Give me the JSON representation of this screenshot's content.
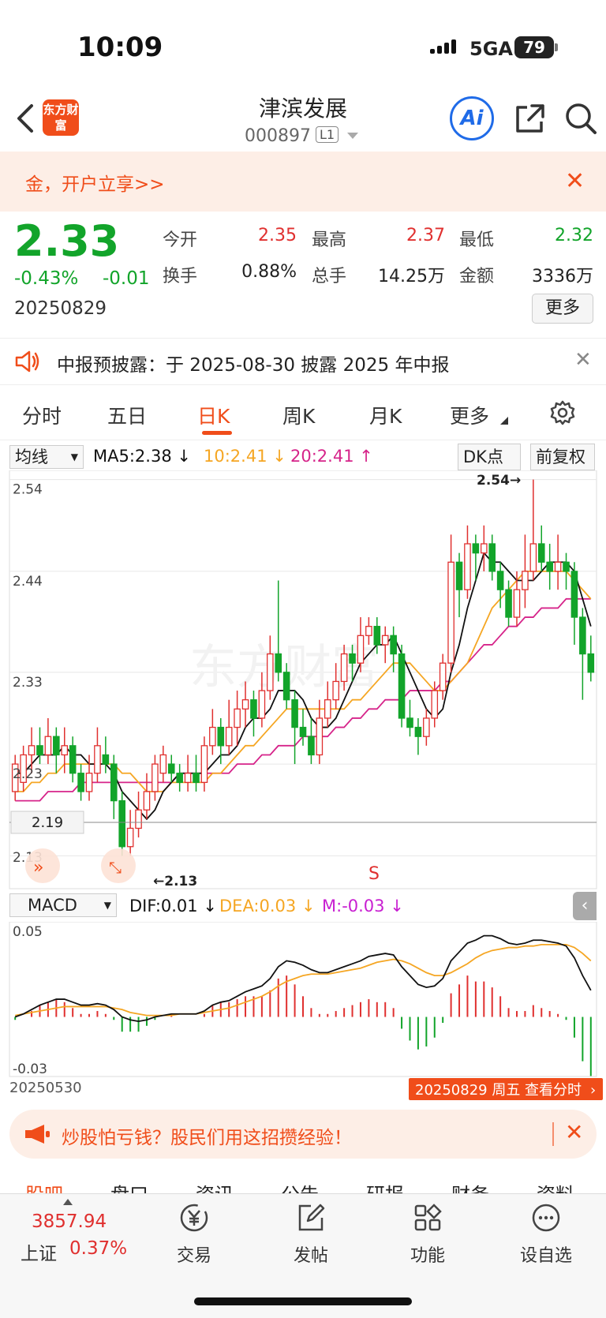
{
  "status_bar": {
    "time": "10:09",
    "network": "5GA",
    "battery": "79"
  },
  "header": {
    "logo_text": "东方财富",
    "stock_name": "津滨发展",
    "stock_code": "000897",
    "level_badge": "L1",
    "ai_label": "Ai"
  },
  "promo": {
    "text": "金，开户立享>>",
    "close": "✕"
  },
  "quote": {
    "price": "2.33",
    "change_pct": "-0.43%",
    "change_amt": "-0.01",
    "date": "20250829",
    "fields": [
      {
        "label": "今开",
        "value": "2.35",
        "color": "#e0302f"
      },
      {
        "label": "最高",
        "value": "2.37",
        "color": "#e0302f"
      },
      {
        "label": "最低",
        "value": "2.32",
        "color": "#12a42a"
      },
      {
        "label": "换手",
        "value": "0.88%",
        "color": "#222222"
      },
      {
        "label": "总手",
        "value": "14.25万",
        "color": "#222222"
      },
      {
        "label": "金额",
        "value": "3336万",
        "color": "#222222"
      }
    ],
    "more_label": "更多"
  },
  "notice": {
    "text": "中报预披露：于 2025-08-30 披露 2025 年中报",
    "close": "✕"
  },
  "tabs": {
    "items": [
      "分时",
      "五日",
      "日K",
      "周K",
      "月K",
      "更多"
    ],
    "active": "日K"
  },
  "ma_bar": {
    "selector": "均线",
    "ma5": "MA5:2.38",
    "ma10": "10:2.41",
    "ma20": "20:2.41",
    "dk_label": "DK点",
    "adjust_label": "前复权"
  },
  "macd_bar": {
    "selector": "MACD",
    "dif": "DIF:0.01",
    "dea": "DEA:0.03",
    "m": "M:-0.03"
  },
  "colors": {
    "up": "#e0302f",
    "down": "#12a42a",
    "ma5": "#111111",
    "ma10": "#f5a623",
    "ma20": "#d6248a",
    "accent": "#f04d1a"
  },
  "chart_data": {
    "type": "candlestick",
    "y_ticks": [
      "2.54",
      "2.44",
      "2.33",
      "2.23",
      "2.13"
    ],
    "ylim": [
      2.12,
      2.55
    ],
    "high_marker": "2.54",
    "low_marker": "2.13",
    "crosshair_value": "2.19",
    "signal_marker": "S",
    "start_date": "20250530",
    "end_label": "20250829 周五 查看分时",
    "macd_ticks": [
      "0.05",
      "-0.03"
    ],
    "macd_ylim": [
      -0.035,
      0.058
    ],
    "candles": [
      [
        2.2,
        2.23,
        2.24,
        2.19
      ],
      [
        2.21,
        2.24,
        2.25,
        2.2
      ],
      [
        2.24,
        2.25,
        2.27,
        2.22
      ],
      [
        2.25,
        2.24,
        2.27,
        2.23
      ],
      [
        2.24,
        2.26,
        2.28,
        2.23
      ],
      [
        2.26,
        2.24,
        2.27,
        2.22
      ],
      [
        2.24,
        2.25,
        2.27,
        2.22
      ],
      [
        2.25,
        2.22,
        2.26,
        2.21
      ],
      [
        2.22,
        2.2,
        2.23,
        2.19
      ],
      [
        2.2,
        2.22,
        2.24,
        2.19
      ],
      [
        2.22,
        2.25,
        2.27,
        2.21
      ],
      [
        2.24,
        2.23,
        2.26,
        2.22
      ],
      [
        2.23,
        2.19,
        2.24,
        2.17
      ],
      [
        2.19,
        2.14,
        2.2,
        2.13
      ],
      [
        2.14,
        2.16,
        2.18,
        2.13
      ],
      [
        2.16,
        2.18,
        2.2,
        2.15
      ],
      [
        2.18,
        2.2,
        2.22,
        2.17
      ],
      [
        2.2,
        2.23,
        2.24,
        2.19
      ],
      [
        2.22,
        2.24,
        2.25,
        2.21
      ],
      [
        2.23,
        2.22,
        2.24,
        2.21
      ],
      [
        2.22,
        2.21,
        2.23,
        2.2
      ],
      [
        2.21,
        2.22,
        2.24,
        2.2
      ],
      [
        2.22,
        2.21,
        2.24,
        2.2
      ],
      [
        2.21,
        2.25,
        2.26,
        2.2
      ],
      [
        2.25,
        2.27,
        2.29,
        2.24
      ],
      [
        2.27,
        2.25,
        2.28,
        2.23
      ],
      [
        2.25,
        2.27,
        2.3,
        2.24
      ],
      [
        2.27,
        2.29,
        2.31,
        2.25
      ],
      [
        2.29,
        2.3,
        2.32,
        2.27
      ],
      [
        2.3,
        2.28,
        2.31,
        2.26
      ],
      [
        2.28,
        2.31,
        2.33,
        2.27
      ],
      [
        2.31,
        2.35,
        2.37,
        2.3
      ],
      [
        2.35,
        2.33,
        2.43,
        2.32
      ],
      [
        2.33,
        2.3,
        2.34,
        2.29
      ],
      [
        2.3,
        2.27,
        2.31,
        2.23
      ],
      [
        2.27,
        2.26,
        2.29,
        2.25
      ],
      [
        2.26,
        2.24,
        2.28,
        2.23
      ],
      [
        2.24,
        2.28,
        2.3,
        2.23
      ],
      [
        2.28,
        2.3,
        2.32,
        2.27
      ],
      [
        2.3,
        2.32,
        2.34,
        2.29
      ],
      [
        2.32,
        2.35,
        2.36,
        2.31
      ],
      [
        2.35,
        2.34,
        2.36,
        2.32
      ],
      [
        2.34,
        2.37,
        2.39,
        2.33
      ],
      [
        2.37,
        2.38,
        2.39,
        2.36
      ],
      [
        2.38,
        2.36,
        2.39,
        2.35
      ],
      [
        2.36,
        2.37,
        2.38,
        2.34
      ],
      [
        2.37,
        2.35,
        2.38,
        2.33
      ],
      [
        2.35,
        2.28,
        2.36,
        2.27
      ],
      [
        2.28,
        2.27,
        2.3,
        2.26
      ],
      [
        2.27,
        2.26,
        2.28,
        2.24
      ],
      [
        2.26,
        2.28,
        2.29,
        2.25
      ],
      [
        2.28,
        2.31,
        2.32,
        2.27
      ],
      [
        2.31,
        2.34,
        2.35,
        2.3
      ],
      [
        2.34,
        2.45,
        2.48,
        2.33
      ],
      [
        2.45,
        2.42,
        2.46,
        2.39
      ],
      [
        2.42,
        2.47,
        2.49,
        2.41
      ],
      [
        2.47,
        2.46,
        2.48,
        2.43
      ],
      [
        2.46,
        2.47,
        2.49,
        2.44
      ],
      [
        2.47,
        2.44,
        2.48,
        2.43
      ],
      [
        2.44,
        2.42,
        2.45,
        2.4
      ],
      [
        2.42,
        2.39,
        2.43,
        2.38
      ],
      [
        2.39,
        2.42,
        2.44,
        2.38
      ],
      [
        2.42,
        2.44,
        2.48,
        2.4
      ],
      [
        2.44,
        2.47,
        2.54,
        2.43
      ],
      [
        2.47,
        2.45,
        2.49,
        2.44
      ],
      [
        2.45,
        2.44,
        2.47,
        2.42
      ],
      [
        2.44,
        2.45,
        2.48,
        2.42
      ],
      [
        2.45,
        2.44,
        2.46,
        2.42
      ],
      [
        2.44,
        2.39,
        2.45,
        2.36
      ],
      [
        2.39,
        2.35,
        2.4,
        2.3
      ],
      [
        2.35,
        2.33,
        2.37,
        2.32
      ]
    ],
    "ma5": [
      2.22,
      2.22,
      2.23,
      2.24,
      2.24,
      2.24,
      2.25,
      2.24,
      2.24,
      2.23,
      2.23,
      2.23,
      2.22,
      2.2,
      2.19,
      2.18,
      2.17,
      2.18,
      2.2,
      2.21,
      2.22,
      2.22,
      2.22,
      2.22,
      2.23,
      2.24,
      2.24,
      2.25,
      2.27,
      2.28,
      2.28,
      2.29,
      2.31,
      2.31,
      2.31,
      2.3,
      2.28,
      2.27,
      2.27,
      2.28,
      2.3,
      2.32,
      2.34,
      2.35,
      2.36,
      2.36,
      2.37,
      2.35,
      2.33,
      2.31,
      2.29,
      2.28,
      2.29,
      2.33,
      2.36,
      2.4,
      2.43,
      2.46,
      2.45,
      2.45,
      2.44,
      2.43,
      2.43,
      2.43,
      2.44,
      2.45,
      2.45,
      2.45,
      2.44,
      2.41,
      2.38
    ],
    "ma10": [
      2.2,
      2.2,
      2.21,
      2.21,
      2.22,
      2.22,
      2.23,
      2.23,
      2.23,
      2.23,
      2.23,
      2.23,
      2.23,
      2.22,
      2.22,
      2.21,
      2.2,
      2.2,
      2.2,
      2.21,
      2.21,
      2.21,
      2.21,
      2.21,
      2.22,
      2.22,
      2.23,
      2.24,
      2.25,
      2.25,
      2.26,
      2.27,
      2.28,
      2.29,
      2.29,
      2.29,
      2.29,
      2.29,
      2.29,
      2.29,
      2.29,
      2.3,
      2.3,
      2.31,
      2.32,
      2.33,
      2.34,
      2.34,
      2.34,
      2.33,
      2.32,
      2.31,
      2.31,
      2.32,
      2.33,
      2.34,
      2.36,
      2.38,
      2.4,
      2.41,
      2.42,
      2.43,
      2.44,
      2.44,
      2.44,
      2.44,
      2.44,
      2.44,
      2.43,
      2.42,
      2.41
    ],
    "ma20": [
      2.19,
      2.19,
      2.19,
      2.19,
      2.2,
      2.2,
      2.2,
      2.2,
      2.21,
      2.21,
      2.21,
      2.21,
      2.21,
      2.21,
      2.21,
      2.21,
      2.21,
      2.21,
      2.21,
      2.21,
      2.22,
      2.22,
      2.22,
      2.22,
      2.22,
      2.22,
      2.22,
      2.23,
      2.23,
      2.23,
      2.24,
      2.24,
      2.25,
      2.25,
      2.25,
      2.26,
      2.26,
      2.26,
      2.26,
      2.27,
      2.27,
      2.28,
      2.28,
      2.29,
      2.29,
      2.3,
      2.3,
      2.3,
      2.31,
      2.31,
      2.31,
      2.31,
      2.32,
      2.32,
      2.33,
      2.34,
      2.35,
      2.36,
      2.36,
      2.37,
      2.38,
      2.38,
      2.39,
      2.39,
      2.4,
      2.4,
      2.4,
      2.41,
      2.41,
      2.41,
      2.41
    ],
    "dif": [
      0.0,
      0.002,
      0.005,
      0.008,
      0.01,
      0.012,
      0.012,
      0.01,
      0.008,
      0.008,
      0.009,
      0.008,
      0.005,
      0.0,
      -0.002,
      -0.003,
      -0.002,
      0.0,
      0.001,
      0.002,
      0.002,
      0.002,
      0.002,
      0.004,
      0.008,
      0.01,
      0.011,
      0.014,
      0.017,
      0.019,
      0.021,
      0.026,
      0.034,
      0.038,
      0.037,
      0.035,
      0.032,
      0.03,
      0.03,
      0.032,
      0.034,
      0.036,
      0.038,
      0.041,
      0.042,
      0.043,
      0.042,
      0.034,
      0.028,
      0.022,
      0.02,
      0.021,
      0.026,
      0.038,
      0.044,
      0.05,
      0.052,
      0.055,
      0.055,
      0.053,
      0.05,
      0.049,
      0.05,
      0.052,
      0.052,
      0.051,
      0.05,
      0.048,
      0.04,
      0.028,
      0.018
    ],
    "dea": [
      0.001,
      0.002,
      0.003,
      0.004,
      0.005,
      0.006,
      0.007,
      0.007,
      0.007,
      0.007,
      0.007,
      0.007,
      0.006,
      0.005,
      0.003,
      0.002,
      0.001,
      0.001,
      0.001,
      0.001,
      0.002,
      0.002,
      0.002,
      0.003,
      0.004,
      0.005,
      0.006,
      0.008,
      0.01,
      0.012,
      0.014,
      0.017,
      0.021,
      0.024,
      0.026,
      0.028,
      0.029,
      0.029,
      0.029,
      0.03,
      0.031,
      0.032,
      0.033,
      0.035,
      0.037,
      0.038,
      0.039,
      0.038,
      0.036,
      0.033,
      0.03,
      0.028,
      0.028,
      0.03,
      0.033,
      0.036,
      0.04,
      0.043,
      0.045,
      0.046,
      0.047,
      0.047,
      0.048,
      0.048,
      0.049,
      0.049,
      0.049,
      0.049,
      0.047,
      0.043,
      0.038
    ]
  },
  "bottom_ad": {
    "text": "炒股怕亏钱？股民们用这招攒经验！",
    "close": "✕"
  },
  "subtabs": [
    "股吧",
    "盘口",
    "资讯",
    "公告",
    "研报",
    "财务",
    "资料"
  ],
  "bottom_nav": {
    "index_value": "3857.94",
    "index_name": "上证",
    "index_pct": "0.37%",
    "items": [
      {
        "label": "交易",
        "icon": "yen-circle-icon"
      },
      {
        "label": "发帖",
        "icon": "edit-icon"
      },
      {
        "label": "功能",
        "icon": "grid-icon"
      },
      {
        "label": "设自选",
        "icon": "more-circle-icon"
      }
    ]
  }
}
